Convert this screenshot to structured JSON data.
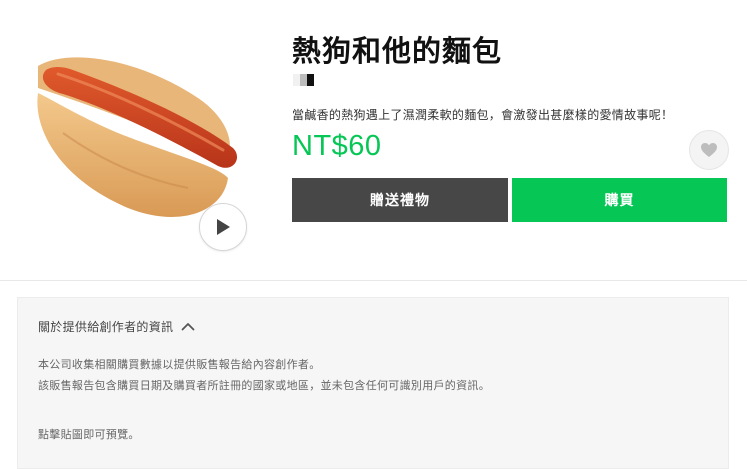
{
  "product": {
    "title": "熱狗和他的麵包",
    "description": "當鹹香的熱狗遇上了濕潤柔軟的麵包，會激發出甚麼樣的愛情故事呢！",
    "price": "NT$60"
  },
  "actions": {
    "gift_label": "贈送禮物",
    "buy_label": "購買"
  },
  "icons": {
    "play": "play-icon",
    "wishlist": "heart-icon",
    "toggle": "chevron-up-icon"
  },
  "info": {
    "heading": "關於提供給創作者的資訊",
    "line1": "本公司收集相關購買數據以提供販售報告給內容創作者。",
    "line2": "該販售報告包含購買日期及購買者所註冊的國家或地區，並未包含任何可識別用戶的資訊。",
    "hint": "點擊貼圖即可預覽。"
  },
  "colors": {
    "accent": "#06c755",
    "gift_button": "#474747",
    "panel_bg": "#f6f6f6"
  }
}
